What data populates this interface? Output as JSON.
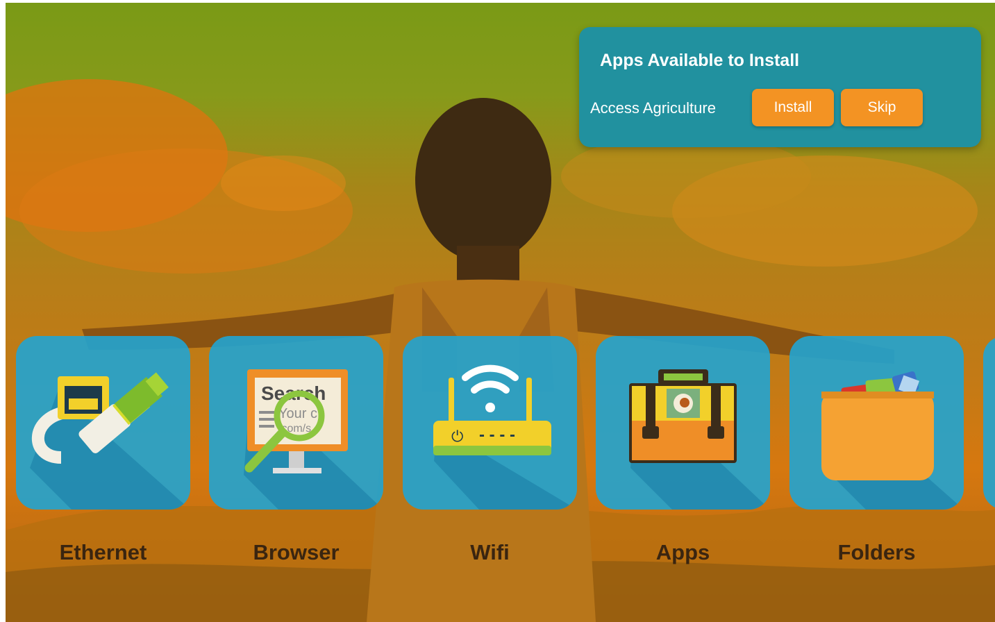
{
  "install_prompt": {
    "title": "Apps Available to Install",
    "app_name": "Access Agriculture",
    "install_label": "Install",
    "skip_label": "Skip"
  },
  "tiles": [
    {
      "label": "Ethernet",
      "icon": "ethernet-cable-icon"
    },
    {
      "label": "Browser",
      "icon": "browser-search-icon",
      "icon_text": {
        "search": "Search",
        "line1": "Your c",
        "line2": ".com/s"
      }
    },
    {
      "label": "Wifi",
      "icon": "wifi-router-icon",
      "icon_text": {
        "power": "⏻",
        "dashes": "- - - -"
      }
    },
    {
      "label": "Apps",
      "icon": "toolbox-icon"
    },
    {
      "label": "Folders",
      "icon": "folder-icon"
    }
  ],
  "colors": {
    "card": "#21919f",
    "button": "#f39323",
    "tile": "#21a4d2",
    "label": "#3a2510",
    "background_top": "#7a9a16",
    "background_bottom": "#c27a16"
  }
}
